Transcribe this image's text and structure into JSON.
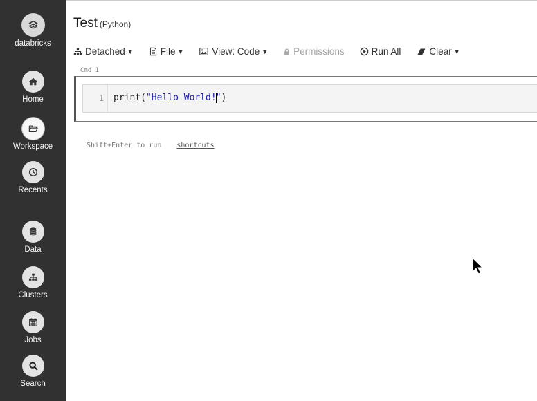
{
  "sidebar": {
    "logo_label": "databricks",
    "items": [
      {
        "label": "Home",
        "icon": "home-icon"
      },
      {
        "label": "Workspace",
        "icon": "folder-open-icon",
        "active": true
      },
      {
        "label": "Recents",
        "icon": "clock-icon"
      },
      {
        "label": "Data",
        "icon": "database-icon"
      },
      {
        "label": "Clusters",
        "icon": "sitemap-icon"
      },
      {
        "label": "Jobs",
        "icon": "calendar-icon"
      },
      {
        "label": "Search",
        "icon": "search-icon"
      }
    ]
  },
  "notebook": {
    "title": "Test",
    "language": "(Python)"
  },
  "toolbar": {
    "detached": "Detached",
    "file": "File",
    "view": "View: Code",
    "permissions": "Permissions",
    "run_all": "Run All",
    "clear": "Clear"
  },
  "cell": {
    "label": "Cmd 1",
    "line_number": "1",
    "code_before": "print(",
    "code_string_a": "\"Hello World!",
    "code_string_b": "\"",
    "code_after": ")"
  },
  "hint": {
    "text": "Shift+Enter to run",
    "link": "shortcuts"
  },
  "colors": {
    "sidebar_bg": "#313131",
    "string": "#1a1aa6"
  }
}
